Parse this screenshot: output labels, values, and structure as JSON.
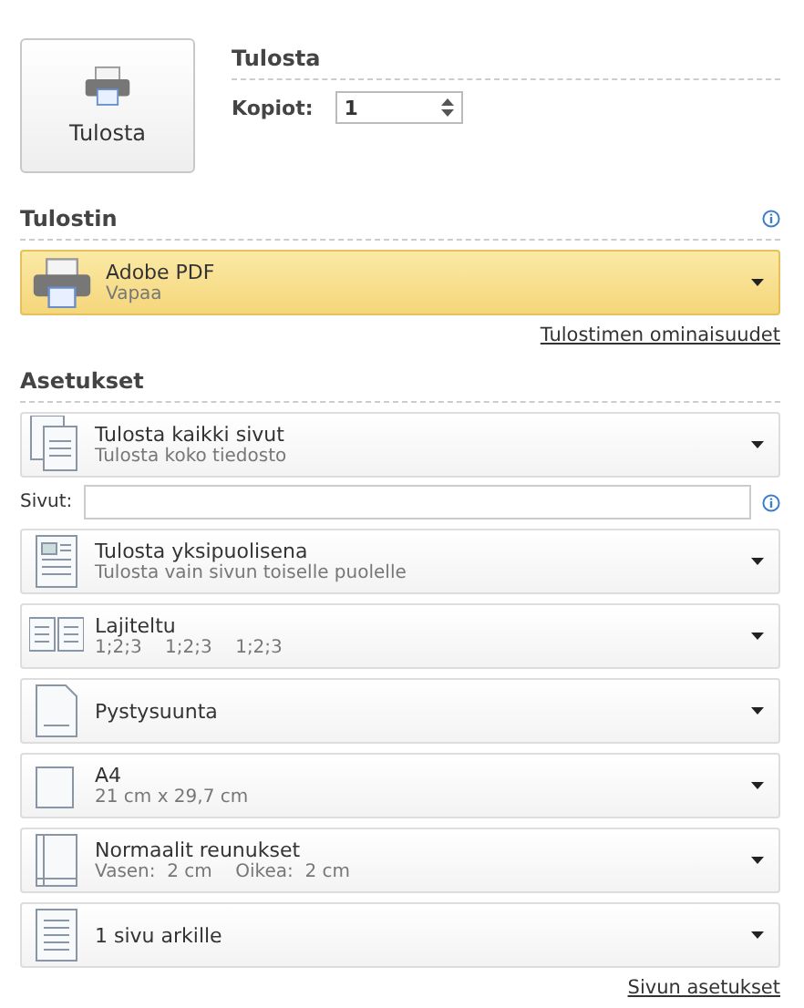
{
  "print_button": {
    "label": "Tulosta"
  },
  "print_section": {
    "title": "Tulosta",
    "copies_label": "Kopiot:",
    "copies_value": "1"
  },
  "printer_section": {
    "title": "Tulostin",
    "printer": {
      "name": "Adobe PDF",
      "status": "Vapaa",
      "selected": true
    },
    "link": "Tulostimen ominaisuudet"
  },
  "settings_section": {
    "title": "Asetukset",
    "items": [
      {
        "kind": "dropdown",
        "title": "Tulosta kaikki sivut",
        "subtitle": "Tulosta koko tiedosto"
      },
      {
        "kind": "field",
        "label": "Sivut:"
      },
      {
        "kind": "dropdown",
        "title": "Tulosta yksipuolisena",
        "subtitle": "Tulosta vain sivun toiselle puolelle"
      },
      {
        "kind": "dropdown",
        "title": "Lajiteltu",
        "subtitle": "1;2;3    1;2;3    1;2;3"
      },
      {
        "kind": "dropdown",
        "title": "Pystysuunta"
      },
      {
        "kind": "dropdown",
        "title": "A4",
        "subtitle": "21 cm x 29,7 cm"
      },
      {
        "kind": "dropdown",
        "title": "Normaalit reunukset",
        "subtitle": "Vasen:  2 cm    Oikea:  2 cm"
      },
      {
        "kind": "dropdown",
        "title": "1 sivu arkille"
      }
    ],
    "link": "Sivun asetukset"
  }
}
